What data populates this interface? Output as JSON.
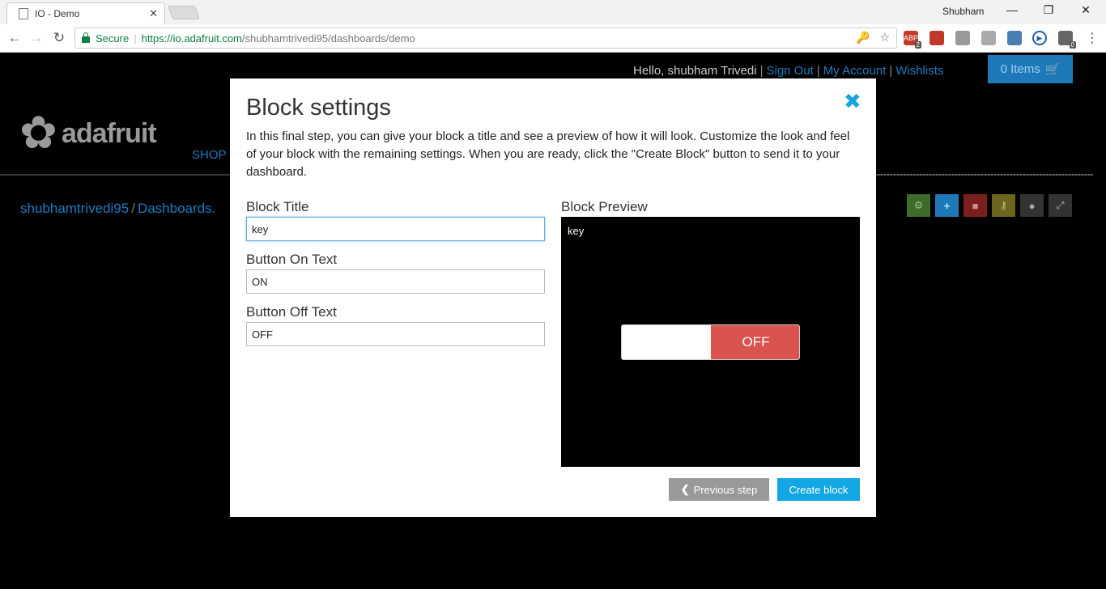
{
  "browser": {
    "tab_title": "IO - Demo",
    "tab_close": "✕",
    "profile_name": "Shubham",
    "secure_label": "Secure",
    "url_host": "https://io.adafruit.com",
    "url_path": "/shubhamtrivedi95/dashboards/demo",
    "ext_abp_badge": "2",
    "ext_last_badge": "0"
  },
  "site": {
    "greeting": "Hello, shubham Trivedi",
    "sign_out": "Sign Out",
    "my_account": "My Account",
    "wishlists": "Wishlists",
    "cart_label": "0 Items",
    "logo_text": "adafruit",
    "shop_link": "SHOP",
    "breadcrumb_user": "shubhamtrivedi95",
    "breadcrumb_dashboards": "Dashboards."
  },
  "modal": {
    "title": "Block settings",
    "intro": "In this final step, you can give your block a title and see a preview of how it will look. Customize the look and feel of your block with the remaining settings. When you are ready, click the \"Create Block\" button to send it to your dashboard.",
    "block_title_label": "Block Title",
    "block_title_value": "key",
    "on_text_label": "Button On Text",
    "on_text_value": "ON",
    "off_text_label": "Button Off Text",
    "off_text_value": "OFF",
    "preview_label": "Block Preview",
    "preview_block_title": "key",
    "preview_toggle_state": "OFF",
    "prev_button": "Previous step",
    "create_button": "Create block"
  },
  "colors": {
    "accent_blue": "#12a7e3",
    "toggle_off_red": "#d9534f",
    "link_blue": "#1e7bbf"
  }
}
